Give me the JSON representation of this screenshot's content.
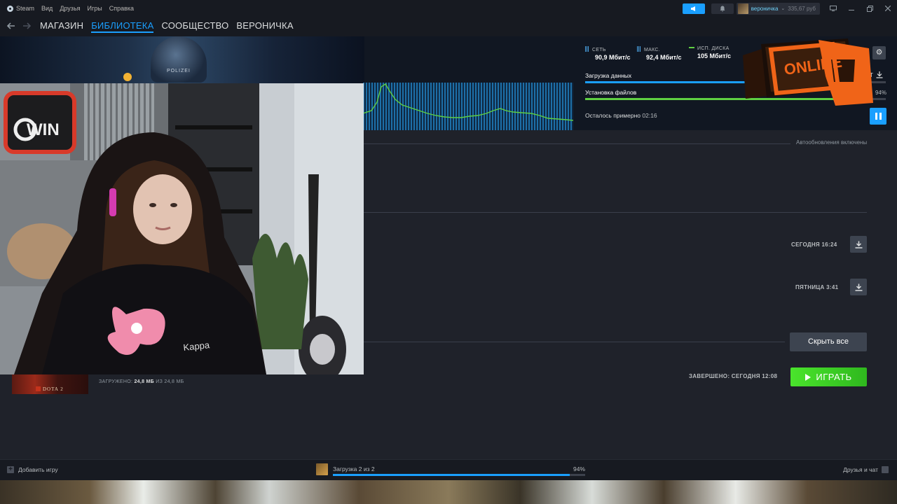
{
  "menubar": {
    "app_name": "Steam",
    "items": [
      "Вид",
      "Друзья",
      "Игры",
      "Справка"
    ],
    "username": "вероничка",
    "wallet": "335,67 руб"
  },
  "nav": {
    "links": [
      "МАГАЗИН",
      "БИБЛИОТЕКА",
      "СООБЩЕСТВО",
      "ВЕРОНИЧКА"
    ],
    "active_index": 1
  },
  "banner": {
    "art_text": "POLIZEI"
  },
  "stats": {
    "network": {
      "label": "СЕТЬ",
      "value": "90,9 Мбит/с"
    },
    "max": {
      "label": "МАКС.",
      "value": "92,4 Мбит/с"
    },
    "disk": {
      "label": "ИСП. ДИСКА",
      "value": "105 Мбит/с"
    }
  },
  "download": {
    "data_label": "Загрузка данных",
    "data_progress": 0.58,
    "install_label": "Установка файлов",
    "install_progress": 0.94,
    "install_percent": "94%",
    "eta_label": "Осталось примерно",
    "eta_time": "02:16",
    "partial_right_text": "АЙТ"
  },
  "main": {
    "autoupdate_text": "Автообновления включены",
    "queue": [
      {
        "date": "СЕГОДНЯ 16:24"
      },
      {
        "date": "ПЯТНИЦА 3:41"
      }
    ],
    "hide_all_label": "Скрыть все",
    "completed": {
      "game": "DOTA 2",
      "loaded_prefix": "ЗАГРУЖЕНО:",
      "loaded_value": "24,8 МБ",
      "loaded_mid": "ИЗ",
      "loaded_total": "24,8 МБ",
      "finished_text": "ЗАВЕРШЕНО: СЕГОДНЯ 12:08",
      "play_label": "ИГРАТЬ"
    }
  },
  "bottombar": {
    "add_game": "Добавить игру",
    "download_status": "Загрузка 2 из 2",
    "download_percent": "94%",
    "download_progress": 0.94,
    "friends_chat": "Друзья и чат"
  },
  "overlay": {
    "logo_text": "ONLINE",
    "webcam_shirt_text": "Kappa",
    "webcam_sign_text": "WIN"
  },
  "colors": {
    "accent": "#1a9fff",
    "play_green": "#4ae42c",
    "install_green": "#5fcf42",
    "overlay_orange": "#f06418"
  }
}
